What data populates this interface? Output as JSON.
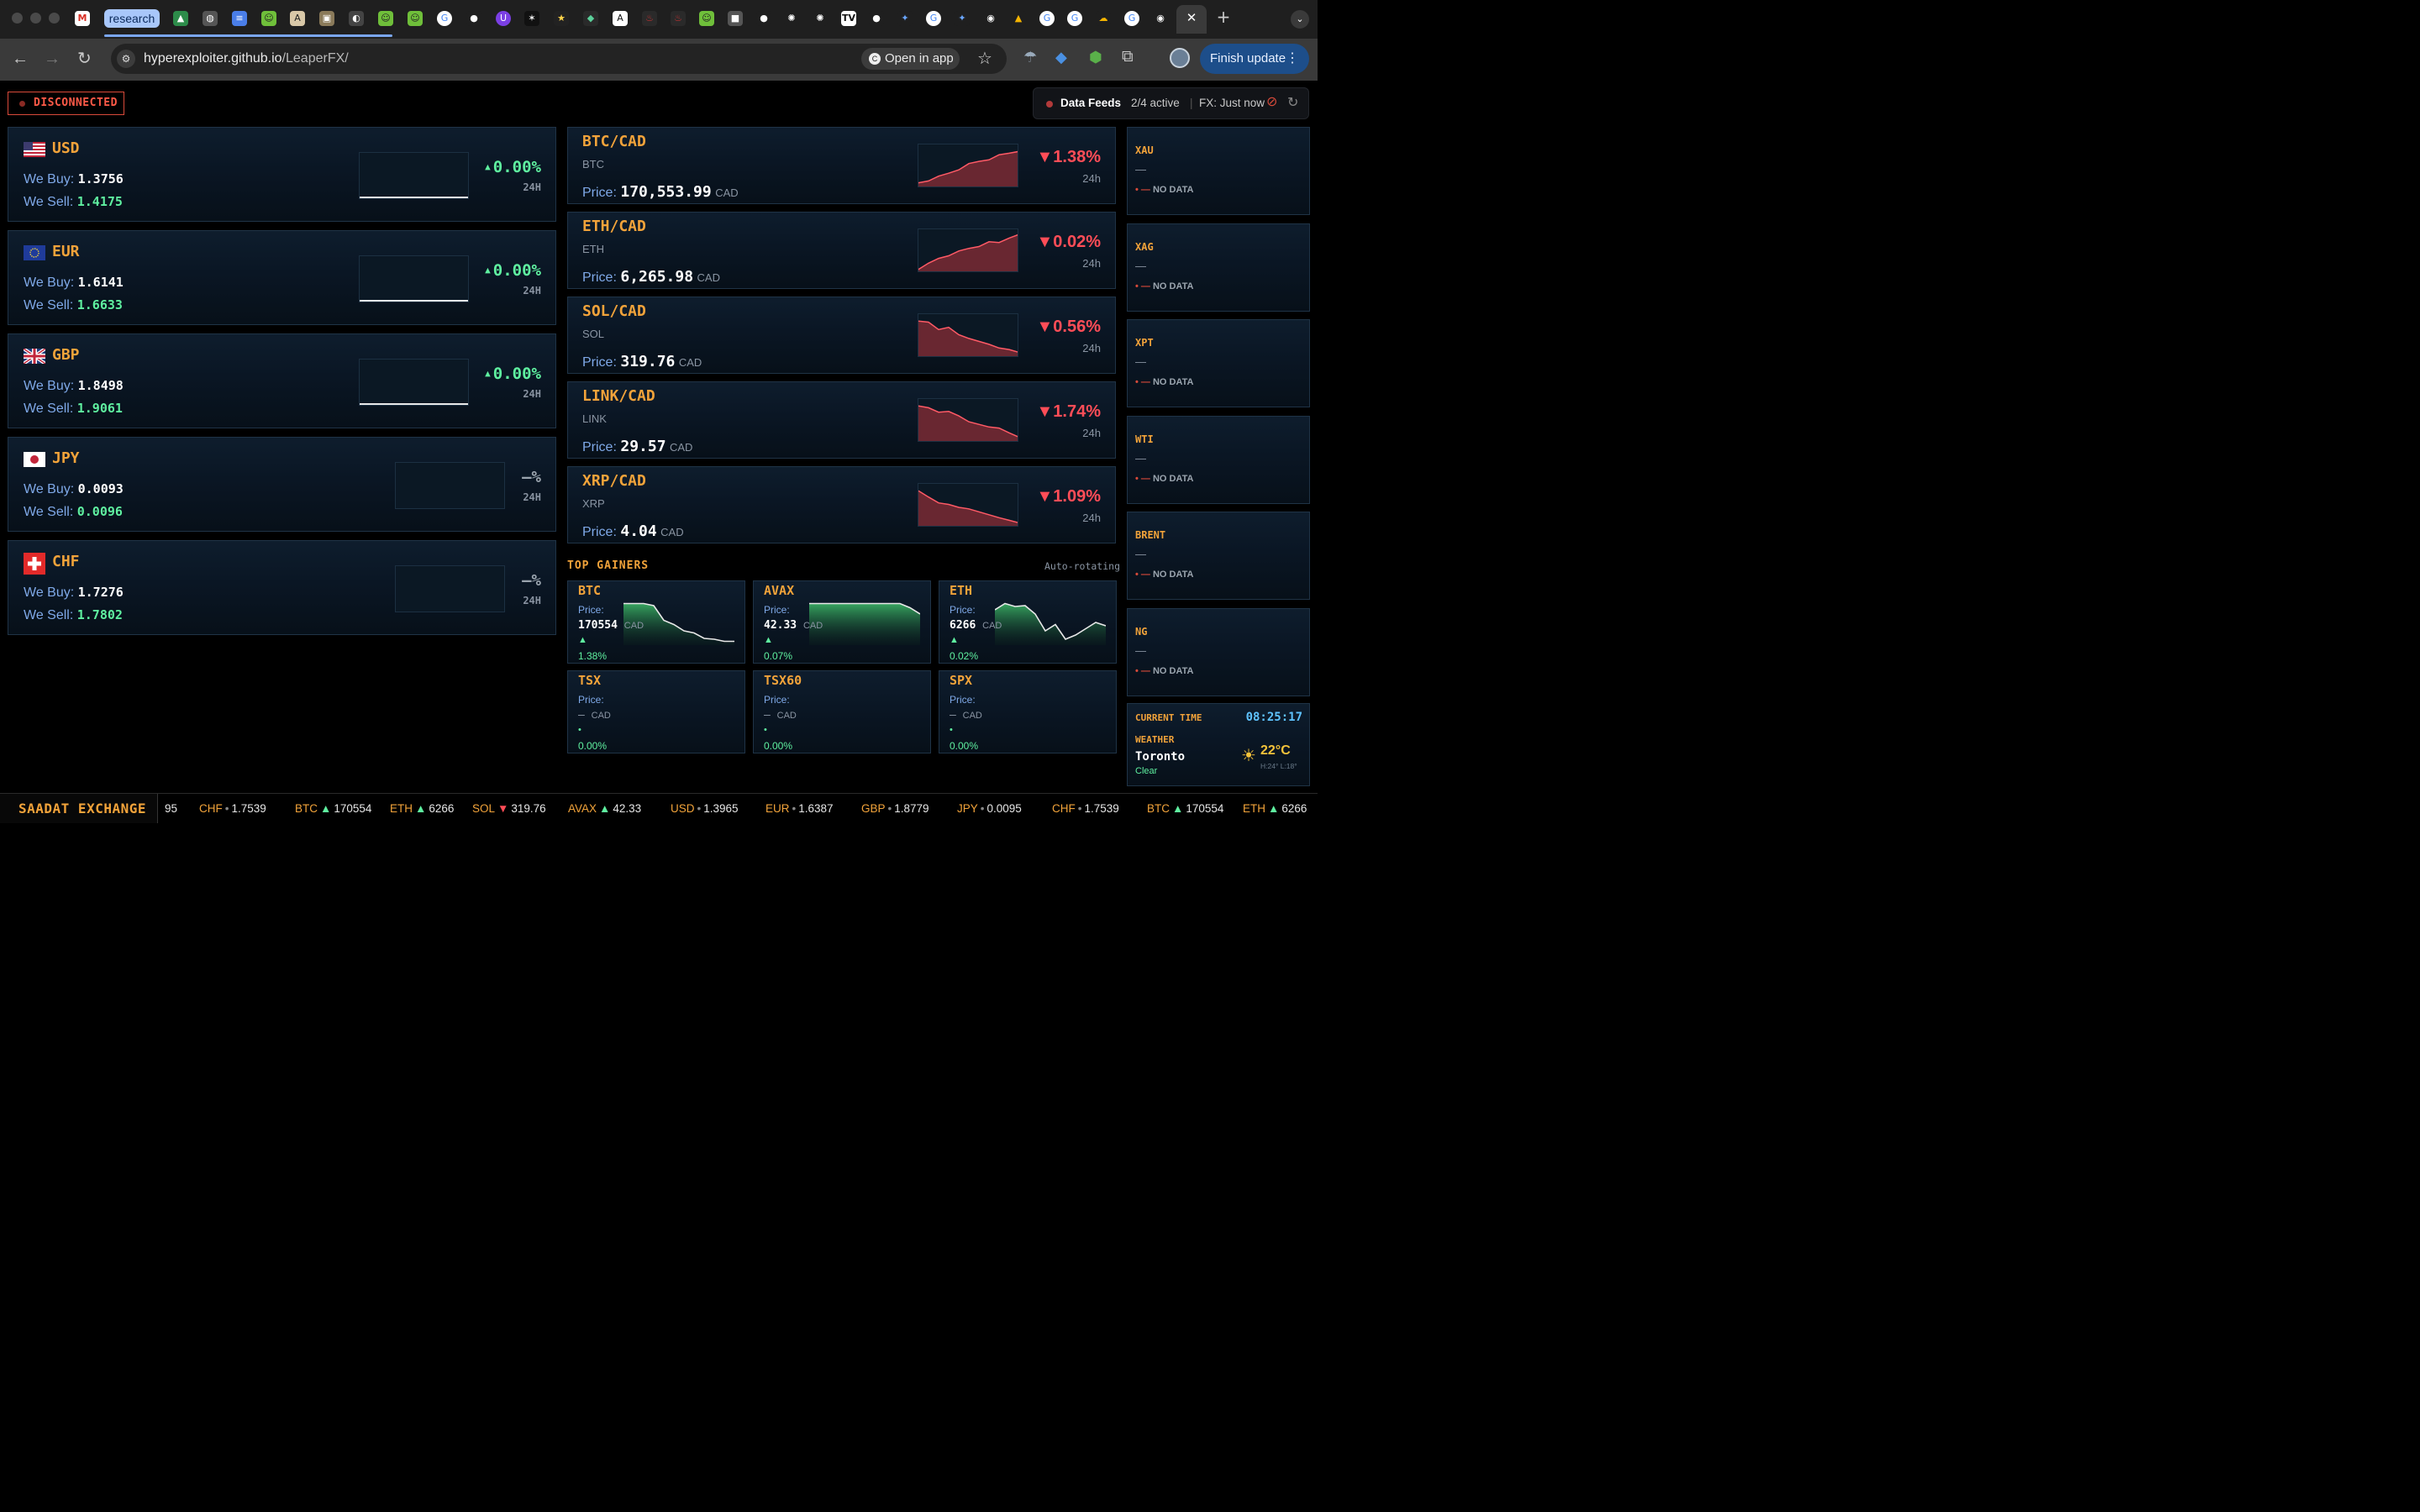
{
  "browser": {
    "tab_group_label": "research",
    "url_host": "hyperexploiter.github.io",
    "url_path": "/LeaperFX/",
    "open_in_app": "Open in app",
    "finish_update": "Finish update"
  },
  "status": {
    "label": "DISCONNECTED"
  },
  "feeds": {
    "label": "Data Feeds",
    "active": "2/4 active",
    "fx": "FX: Just now"
  },
  "fx": [
    {
      "code": "USD",
      "buy_label": "We Buy:",
      "buy": "1.3756",
      "sell_label": "We Sell:",
      "sell": "1.4175",
      "change": "0.00%",
      "period": "24H"
    },
    {
      "code": "EUR",
      "buy_label": "We Buy:",
      "buy": "1.6141",
      "sell_label": "We Sell:",
      "sell": "1.6633",
      "change": "0.00%",
      "period": "24H"
    },
    {
      "code": "GBP",
      "buy_label": "We Buy:",
      "buy": "1.8498",
      "sell_label": "We Sell:",
      "sell": "1.9061",
      "change": "0.00%",
      "period": "24H"
    },
    {
      "code": "JPY",
      "buy_label": "We Buy:",
      "buy": "0.0093",
      "sell_label": "We Sell:",
      "sell": "0.0096",
      "change": "—%",
      "period": "24H"
    },
    {
      "code": "CHF",
      "buy_label": "We Buy:",
      "buy": "1.7276",
      "sell_label": "We Sell:",
      "sell": "1.7802",
      "change": "—%",
      "period": "24H"
    }
  ],
  "crypto": [
    {
      "pair": "BTC/CAD",
      "sym": "BTC",
      "price_label": "Price:",
      "price": "170,553.99",
      "unit": "CAD",
      "change": "▼1.38%",
      "period": "24h"
    },
    {
      "pair": "ETH/CAD",
      "sym": "ETH",
      "price_label": "Price:",
      "price": "6,265.98",
      "unit": "CAD",
      "change": "▼0.02%",
      "period": "24h"
    },
    {
      "pair": "SOL/CAD",
      "sym": "SOL",
      "price_label": "Price:",
      "price": "319.76",
      "unit": "CAD",
      "change": "▼0.56%",
      "period": "24h"
    },
    {
      "pair": "LINK/CAD",
      "sym": "LINK",
      "price_label": "Price:",
      "price": "29.57",
      "unit": "CAD",
      "change": "▼1.74%",
      "period": "24h"
    },
    {
      "pair": "XRP/CAD",
      "sym": "XRP",
      "price_label": "Price:",
      "price": "4.04",
      "unit": "CAD",
      "change": "▼1.09%",
      "period": "24h"
    }
  ],
  "gainers": {
    "title": "TOP GAINERS",
    "note": "Auto-rotating",
    "items": [
      {
        "sym": "BTC",
        "price_label": "Price:",
        "price": "170554",
        "unit": "CAD",
        "arrow": "▲",
        "pct": "1.38%"
      },
      {
        "sym": "AVAX",
        "price_label": "Price:",
        "price": "42.33",
        "unit": "CAD",
        "arrow": "▲",
        "pct": "0.07%"
      },
      {
        "sym": "ETH",
        "price_label": "Price:",
        "price": "6266",
        "unit": "CAD",
        "arrow": "▲",
        "pct": "0.02%"
      },
      {
        "sym": "TSX",
        "price_label": "Price:",
        "price": "—",
        "unit": "CAD",
        "arrow": "•",
        "pct": "0.00%"
      },
      {
        "sym": "TSX60",
        "price_label": "Price:",
        "price": "—",
        "unit": "CAD",
        "arrow": "•",
        "pct": "0.00%"
      },
      {
        "sym": "SPX",
        "price_label": "Price:",
        "price": "—",
        "unit": "CAD",
        "arrow": "•",
        "pct": "0.00%"
      }
    ]
  },
  "commodities": [
    {
      "code": "XAU",
      "value": "—",
      "status": "NO DATA"
    },
    {
      "code": "XAG",
      "value": "—",
      "status": "NO DATA"
    },
    {
      "code": "XPT",
      "value": "—",
      "status": "NO DATA"
    },
    {
      "code": "WTI",
      "value": "—",
      "status": "NO DATA"
    },
    {
      "code": "BRENT",
      "value": "—",
      "status": "NO DATA"
    },
    {
      "code": "NG",
      "value": "—",
      "status": "NO DATA"
    }
  ],
  "clock": {
    "label": "CURRENT TIME",
    "time": "08:25:17",
    "weather_label": "WEATHER",
    "city": "Toronto",
    "condition": "Clear",
    "temp": "22°C",
    "hilo": "H:24° L:18°"
  },
  "ticker": {
    "brand": "SAADAT EXCHANGE",
    "lead": "95",
    "items": [
      {
        "sym": "CHF",
        "sep": "•",
        "val": "1.7539"
      },
      {
        "sym": "BTC",
        "sep": "▲",
        "val": "170554"
      },
      {
        "sym": "ETH",
        "sep": "▲",
        "val": "6266"
      },
      {
        "sym": "SOL",
        "sep": "▼",
        "val": "319.76"
      },
      {
        "sym": "AVAX",
        "sep": "▲",
        "val": "42.33"
      },
      {
        "sym": "USD",
        "sep": "•",
        "val": "1.3965"
      },
      {
        "sym": "EUR",
        "sep": "•",
        "val": "1.6387"
      },
      {
        "sym": "GBP",
        "sep": "•",
        "val": "1.8779"
      },
      {
        "sym": "JPY",
        "sep": "•",
        "val": "0.0095"
      },
      {
        "sym": "CHF",
        "sep": "•",
        "val": "1.7539"
      },
      {
        "sym": "BTC",
        "sep": "▲",
        "val": "170554"
      },
      {
        "sym": "ETH",
        "sep": "▲",
        "val": "6266"
      }
    ]
  }
}
